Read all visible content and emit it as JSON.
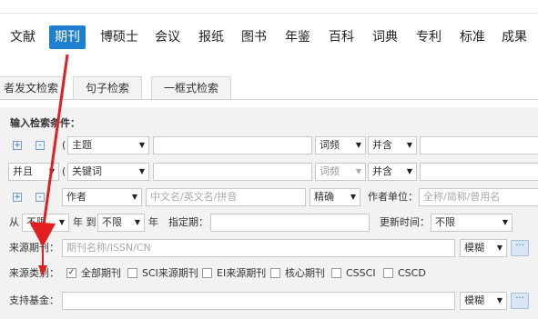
{
  "nav": {
    "items": [
      "文献",
      "期刊",
      "博硕士",
      "会议",
      "报纸",
      "图书",
      "年鉴",
      "百科",
      "词典",
      "专利",
      "标准",
      "成果"
    ],
    "active_index": 1,
    "accent_color": "#1f7fd0"
  },
  "tabs": [
    "者发文检索",
    "句子检索",
    "一框式检索"
  ],
  "form": {
    "heading": "输入检索条件：",
    "rows": [
      {
        "plus_icon": "+",
        "minus_icon": "-",
        "bracket": "(",
        "field": "主题",
        "match": "词频",
        "combine": "并含"
      },
      {
        "logic": "并且",
        "bracket": "(",
        "field": "关键词",
        "match": "词频",
        "combine": "并含"
      },
      {
        "plus_icon": "+",
        "minus_icon": "-",
        "field": "作者",
        "author_placeholder": "中文名/英文名/拼音",
        "precision": "精确",
        "org_label": "作者单位：",
        "org_placeholder": "全称/简称/曾用名"
      }
    ],
    "date_row": {
      "from_label": "从",
      "from_value": "不限",
      "year_to": "年 到",
      "to_value": "不限",
      "year": "年",
      "specify_label": "指定期：",
      "update_label": "更新时间：",
      "update_value": "不限"
    },
    "source": {
      "label": "来源期刊：",
      "placeholder": "期刊名称/ISSN/CN",
      "match": "模糊",
      "more": "···"
    },
    "category": {
      "label": "来源类别：",
      "options": [
        {
          "label": "全部期刊",
          "checked": true
        },
        {
          "label": "SCI来源期刊",
          "checked": false
        },
        {
          "label": "EI来源期刊",
          "checked": false
        },
        {
          "label": "核心期刊",
          "checked": false
        },
        {
          "label": "CSSCI",
          "checked": false
        },
        {
          "label": "CSCD",
          "checked": false
        }
      ]
    },
    "fund": {
      "label": "支持基金：",
      "match": "模糊",
      "more": "···"
    }
  },
  "annotation_color": "#e02020"
}
